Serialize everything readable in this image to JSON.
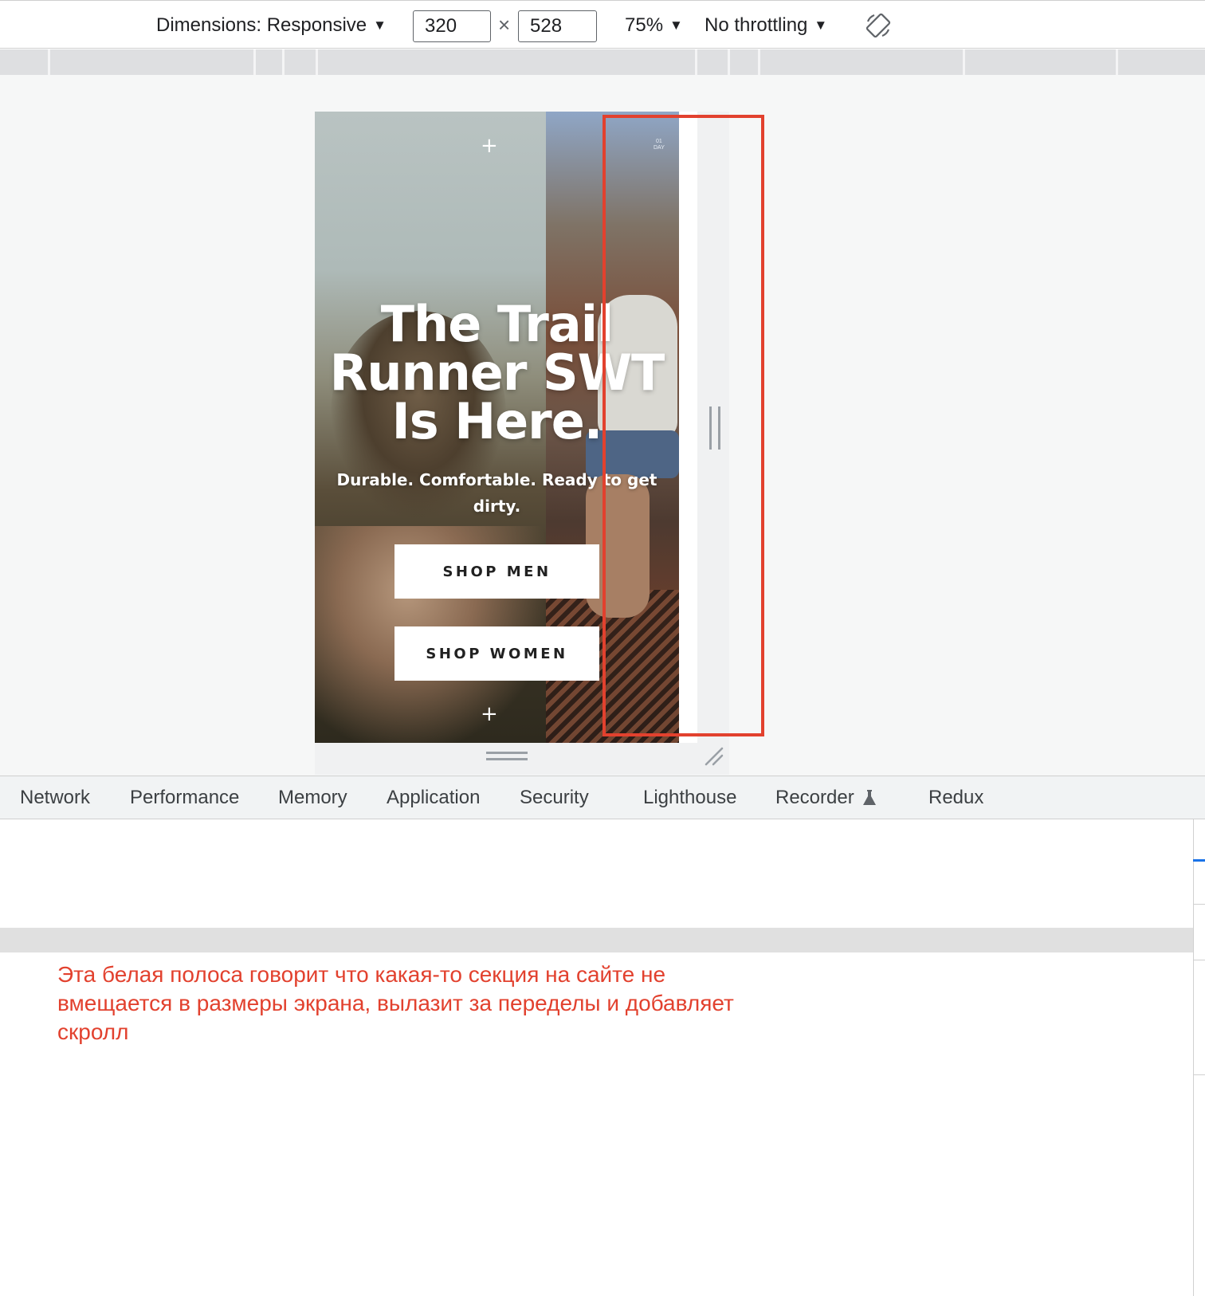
{
  "toolbar": {
    "dimensions_label": "Dimensions: Responsive",
    "width_value": "320",
    "height_value": "528",
    "times_symbol": "×",
    "zoom_label": "75%",
    "throttling_label": "No throttling",
    "dropdown_arrow": "▼",
    "rotate_icon": "rotate-icon"
  },
  "hero": {
    "title": "The Trail\nRunner SWT\nIs Here.",
    "subtitle": "Durable. Comfortable. Ready to get dirty.",
    "day_mark": "01\nDAY",
    "sparkle": "+",
    "buttons": {
      "shop_men": "SHOP MEN",
      "shop_women": "SHOP WOMEN"
    }
  },
  "devtools_tabs": [
    {
      "label": "Network"
    },
    {
      "label": "Performance"
    },
    {
      "label": "Memory"
    },
    {
      "label": "Application"
    },
    {
      "label": "Security"
    },
    {
      "label": "Lighthouse"
    },
    {
      "label": "Recorder"
    },
    {
      "label": "Redux"
    }
  ],
  "annotation": {
    "text": "Эта белая полоса говорит что какая-то секция на сайте не вмещается в размеры экрана, вылазит за переделы и добавляет скролл"
  },
  "colors": {
    "annotation_red": "#e2412e",
    "devtools_blue": "#1a73e8",
    "toolbar_text": "#202124"
  }
}
